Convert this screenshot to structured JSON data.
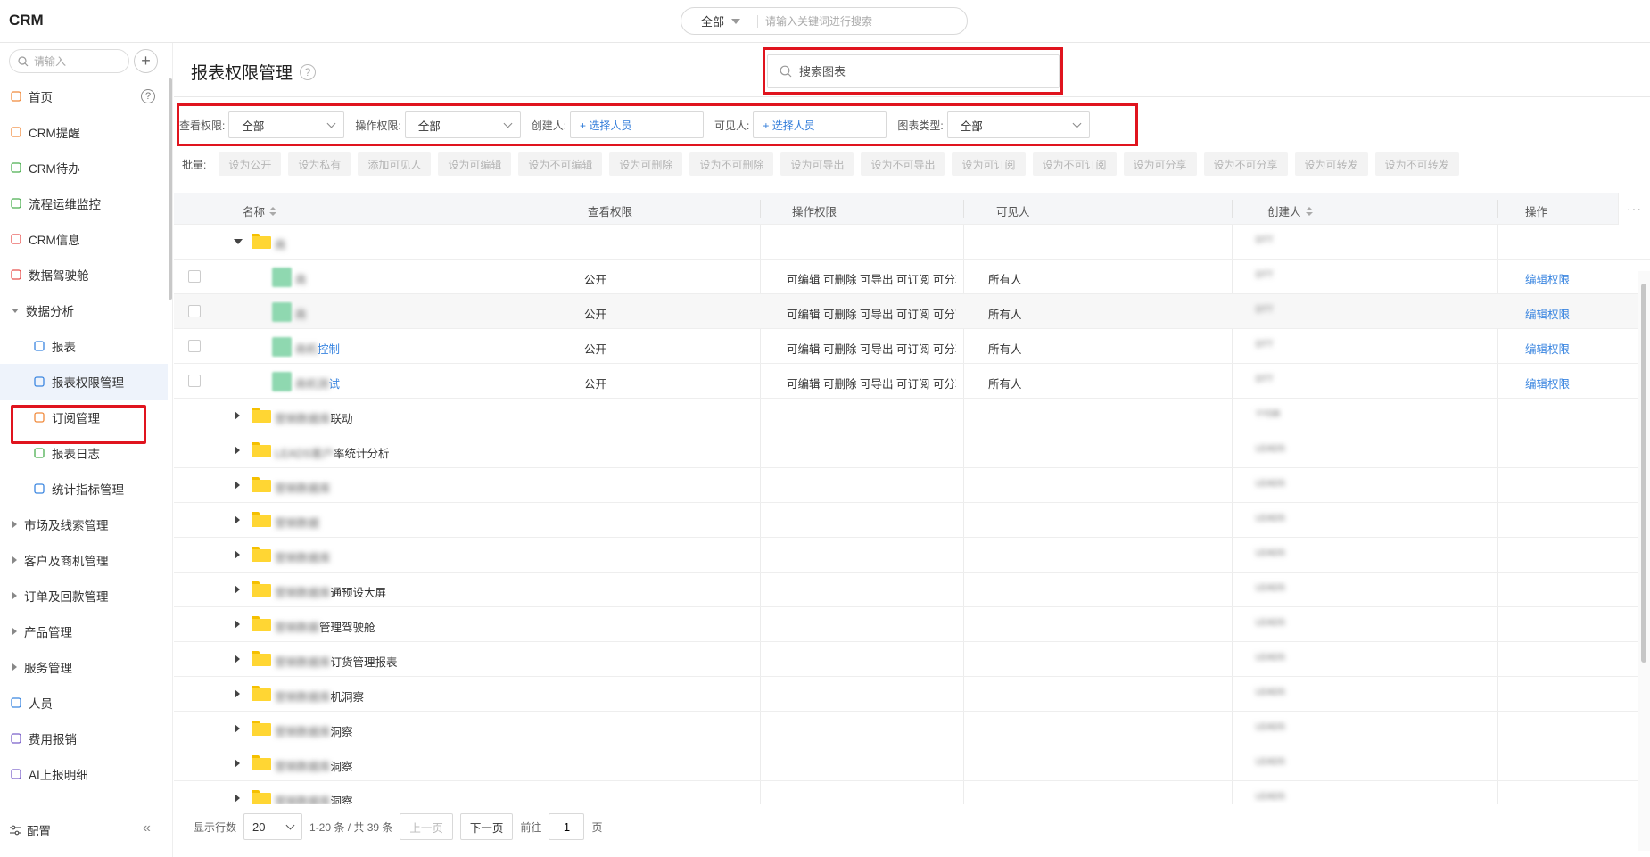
{
  "app": {
    "title": "CRM"
  },
  "global_search": {
    "scope": "全部",
    "placeholder": "请输入关键词进行搜索"
  },
  "sidebar": {
    "search_placeholder": "请输入",
    "items": [
      {
        "label": "首页",
        "icon": "home-icon",
        "color": "#f08a3c"
      },
      {
        "label": "CRM提醒",
        "icon": "bell-icon",
        "color": "#f08a3c"
      },
      {
        "label": "CRM待办",
        "icon": "check-circle-icon",
        "color": "#4caf50"
      },
      {
        "label": "流程运维监控",
        "icon": "flow-icon",
        "color": "#4caf50"
      },
      {
        "label": "CRM信息",
        "icon": "clock-icon",
        "color": "#e8504d"
      },
      {
        "label": "数据驾驶舱",
        "icon": "dashboard-icon",
        "color": "#e8504d"
      },
      {
        "label": "数据分析",
        "icon": "",
        "color": ""
      },
      {
        "label": "报表",
        "icon": "report-icon",
        "color": "#3b86e0"
      },
      {
        "label": "报表权限管理",
        "icon": "report-permission-icon",
        "color": "#3b86e0"
      },
      {
        "label": "订阅管理",
        "icon": "subscribe-icon",
        "color": "#f08a3c"
      },
      {
        "label": "报表日志",
        "icon": "log-icon",
        "color": "#4caf50"
      },
      {
        "label": "统计指标管理",
        "icon": "metrics-icon",
        "color": "#3b86e0"
      },
      {
        "label": "市场及线索管理",
        "icon": "",
        "color": ""
      },
      {
        "label": "客户及商机管理",
        "icon": "",
        "color": ""
      },
      {
        "label": "订单及回款管理",
        "icon": "",
        "color": ""
      },
      {
        "label": "产品管理",
        "icon": "",
        "color": ""
      },
      {
        "label": "服务管理",
        "icon": "",
        "color": ""
      },
      {
        "label": "人员",
        "icon": "people-icon",
        "color": "#3b86e0"
      },
      {
        "label": "费用报销",
        "icon": "flag-icon",
        "color": "#7b61c9"
      },
      {
        "label": "AI上报明细",
        "icon": "flag-icon",
        "color": "#7b61c9"
      }
    ],
    "config_label": "配置"
  },
  "page": {
    "title": "报表权限管理",
    "chart_search_placeholder": "搜索图表"
  },
  "filters": {
    "view_label": "查看权限:",
    "view_value": "全部",
    "op_label": "操作权限:",
    "op_value": "全部",
    "creator_label": "创建人:",
    "creator_value": "+ 选择人员",
    "visible_label": "可见人:",
    "visible_value": "+ 选择人员",
    "type_label": "图表类型:",
    "type_value": "全部"
  },
  "batch": {
    "label": "批量:",
    "buttons": [
      "设为公开",
      "设为私有",
      "添加可见人",
      "设为可编辑",
      "设为不可编辑",
      "设为可删除",
      "设为不可删除",
      "设为可导出",
      "设为不可导出",
      "设为可订阅",
      "设为不可订阅",
      "设为可分享",
      "设为不可分享",
      "设为可转发",
      "设为不可转发"
    ]
  },
  "table": {
    "headers": {
      "name": "名称",
      "view": "查看权限",
      "op": "操作权限",
      "visible": "可见人",
      "creator": "创建人",
      "action": "操作"
    },
    "rows": [
      {
        "type": "folder",
        "expanded": true,
        "name_blur": "商",
        "name": "",
        "creator": "DTT"
      },
      {
        "type": "report",
        "name_blur": "商",
        "name": "",
        "view": "公开",
        "op": "可编辑 可删除 可导出 可订阅 可分享",
        "visible": "所有人",
        "creator": "DTT",
        "action": "编辑权限"
      },
      {
        "type": "report",
        "name_blur": "商",
        "name": "",
        "view": "公开",
        "op": "可编辑 可删除 可导出 可订阅 可分享",
        "visible": "所有人",
        "creator": "DTT",
        "action": "编辑权限"
      },
      {
        "type": "report",
        "name_blur": "商机",
        "name": "控制",
        "view": "公开",
        "op": "可编辑 可删除 可导出 可订阅 可分享",
        "visible": "所有人",
        "creator": "DTT",
        "action": "编辑权限"
      },
      {
        "type": "report",
        "name_blur": "商机测",
        "name": "试",
        "view": "公开",
        "op": "可编辑 可删除 可导出 可订阅 可分享",
        "visible": "所有人",
        "creator": "DTT",
        "action": "编辑权限"
      },
      {
        "type": "folder",
        "expanded": false,
        "name_blur": "营销数据库",
        "name": "联动",
        "creator": "YYDB"
      },
      {
        "type": "folder",
        "expanded": false,
        "name_blur": "LEADS客户",
        "name": "率统计分析",
        "creator": "LEADS"
      },
      {
        "type": "folder",
        "expanded": false,
        "name_blur": "营销数据库",
        "name": "",
        "creator": "LEADS"
      },
      {
        "type": "folder",
        "expanded": false,
        "name_blur": "营销数据",
        "name": "",
        "creator": "LEADS"
      },
      {
        "type": "folder",
        "expanded": false,
        "name_blur": "营销数据库",
        "name": "",
        "creator": "LEADS"
      },
      {
        "type": "folder",
        "expanded": false,
        "name_blur": "营销数据库",
        "name": "通预设大屏",
        "creator": "LEADS"
      },
      {
        "type": "folder",
        "expanded": false,
        "name_blur": "营销数据",
        "name": "管理驾驶舱",
        "creator": "LEADS"
      },
      {
        "type": "folder",
        "expanded": false,
        "name_blur": "营销数据库",
        "name": "订货管理报表",
        "creator": "LEADS"
      },
      {
        "type": "folder",
        "expanded": false,
        "name_blur": "营销数据库",
        "name": "机洞察",
        "creator": "LEADS"
      },
      {
        "type": "folder",
        "expanded": false,
        "name_blur": "营销数据库",
        "name": "洞察",
        "creator": "LEADS"
      },
      {
        "type": "folder",
        "expanded": false,
        "name_blur": "营销数据库",
        "name": "洞察",
        "creator": "LEADS"
      },
      {
        "type": "folder",
        "expanded": false,
        "name_blur": "营销数据库",
        "name": "洞察",
        "creator": "LEADS"
      }
    ]
  },
  "pager": {
    "rows_label": "显示行数",
    "rows_value": "20",
    "range": "1-20 条 / 共 39 条",
    "prev": "上一页",
    "next": "下一页",
    "goto_label": "前往",
    "page_value": "1",
    "page_unit": "页"
  }
}
